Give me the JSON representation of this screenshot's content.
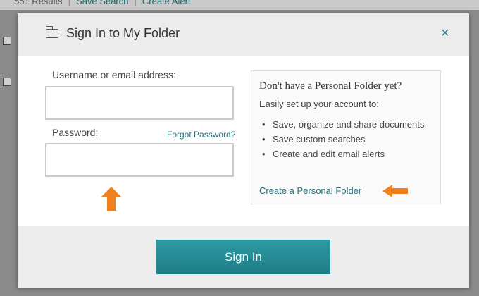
{
  "background": {
    "toolbar": {
      "results_text": "551 Results",
      "save_search_label": "Save Search",
      "create_alert_label": "Create Alert"
    }
  },
  "modal": {
    "title": "Sign In to My Folder",
    "close_label": "×",
    "username_label": "Username or email address:",
    "username_value": "",
    "password_label": "Password:",
    "password_value": "",
    "forgot_password_label": "Forgot Password?",
    "signin_label": "Sign In"
  },
  "promo": {
    "heading": "Don't have a Personal Folder yet?",
    "subheading": "Easily set up your account to:",
    "items": [
      "Save, organize and share documents",
      "Save custom searches",
      "Create and edit email alerts"
    ],
    "create_link_label": "Create a Personal Folder"
  },
  "colors": {
    "accent": "#2a7d86",
    "annotation_arrow": "#f07f1d",
    "overlay": "#7b7b7b"
  },
  "icons": {
    "folder": "folder-icon",
    "close": "close-icon",
    "annotation_up": "arrow-up-icon",
    "annotation_left": "arrow-left-icon"
  }
}
